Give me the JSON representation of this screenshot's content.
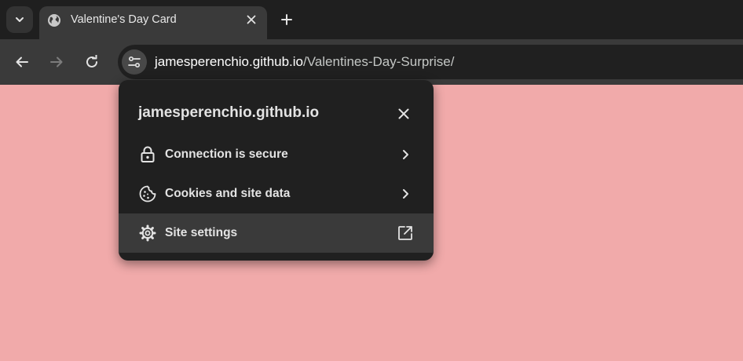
{
  "browser": {
    "tab": {
      "title": "Valentine's Day Card",
      "favicon": "globe-icon"
    },
    "tab_search_icon": "chevron-down-icon",
    "new_tab_icon": "plus-icon",
    "nav": {
      "back_icon": "arrow-left-icon",
      "forward_icon": "arrow-right-icon",
      "reload_icon": "reload-icon"
    },
    "address": {
      "site_info_icon": "tune-icon",
      "host": "jamesperenchio.github.io",
      "path": "/Valentines-Day-Surprise/"
    }
  },
  "site_info_popup": {
    "title": "jamesperenchio.github.io",
    "close_icon": "close-icon",
    "items": [
      {
        "label": "Connection is secure",
        "icon": "lock-icon",
        "trail": "chevron-right-icon"
      },
      {
        "label": "Cookies and site data",
        "icon": "cookie-icon",
        "trail": "chevron-right-icon"
      },
      {
        "label": "Site settings",
        "icon": "gear-icon",
        "trail": "external-link-icon"
      }
    ]
  },
  "colors": {
    "page_background": "#f1aaaa",
    "tabstrip": "#1f1f1f",
    "toolbar": "#3a3a3a",
    "popup": "#202020",
    "popup_hover_row": "#3a3a3a",
    "text": "#e3e3e3"
  }
}
